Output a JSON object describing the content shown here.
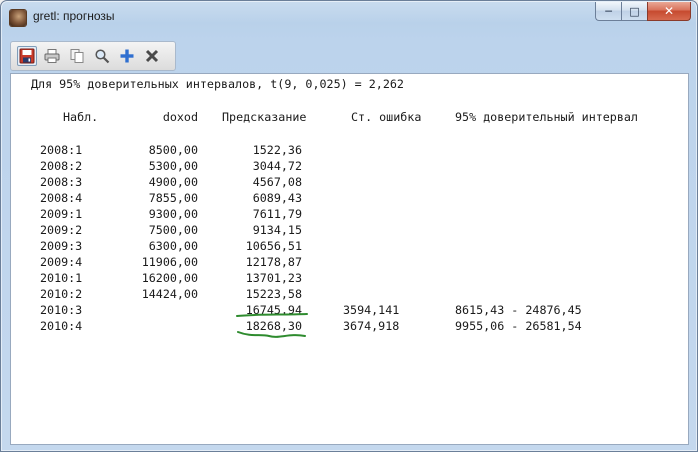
{
  "window": {
    "title": "gretl: прогнозы",
    "buttons": {
      "minimize": "─",
      "maximize": "□",
      "close": "✕"
    }
  },
  "toolbar": {
    "items": [
      {
        "name": "save-icon",
        "tooltip": ""
      },
      {
        "name": "print-icon",
        "tooltip": ""
      },
      {
        "name": "copy-icon",
        "tooltip": ""
      },
      {
        "name": "find-icon",
        "tooltip": ""
      },
      {
        "name": "add-icon",
        "tooltip": ""
      },
      {
        "name": "close-icon",
        "tooltip": ""
      }
    ]
  },
  "output": {
    "interval_line": "Для 95% доверительных интервалов, t(9, 0,025) = 2,262",
    "headers": {
      "obs": "Набл.",
      "doxod": "doxod",
      "prediction": "Предсказание",
      "std_error": "Ст. ошибка",
      "interval": "95% доверительный интервал"
    },
    "rows": [
      {
        "obs": "2008:1",
        "doxod": "8500,00",
        "prediction": "1522,36",
        "std_error": "",
        "interval": ""
      },
      {
        "obs": "2008:2",
        "doxod": "5300,00",
        "prediction": "3044,72",
        "std_error": "",
        "interval": ""
      },
      {
        "obs": "2008:3",
        "doxod": "4900,00",
        "prediction": "4567,08",
        "std_error": "",
        "interval": ""
      },
      {
        "obs": "2008:4",
        "doxod": "7855,00",
        "prediction": "6089,43",
        "std_error": "",
        "interval": ""
      },
      {
        "obs": "2009:1",
        "doxod": "9300,00",
        "prediction": "7611,79",
        "std_error": "",
        "interval": ""
      },
      {
        "obs": "2009:2",
        "doxod": "7500,00",
        "prediction": "9134,15",
        "std_error": "",
        "interval": ""
      },
      {
        "obs": "2009:3",
        "doxod": "6300,00",
        "prediction": "10656,51",
        "std_error": "",
        "interval": ""
      },
      {
        "obs": "2009:4",
        "doxod": "11906,00",
        "prediction": "12178,87",
        "std_error": "",
        "interval": ""
      },
      {
        "obs": "2010:1",
        "doxod": "16200,00",
        "prediction": "13701,23",
        "std_error": "",
        "interval": ""
      },
      {
        "obs": "2010:2",
        "doxod": "14424,00",
        "prediction": "15223,58",
        "std_error": "",
        "interval": ""
      },
      {
        "obs": "2010:3",
        "doxod": "",
        "prediction": "16745,94",
        "std_error": "3594,141",
        "interval": "8615,43 - 24876,45"
      },
      {
        "obs": "2010:4",
        "doxod": "",
        "prediction": "18268,30",
        "std_error": "3674,918",
        "interval": "9955,06 - 26581,54"
      }
    ]
  },
  "annotation": {
    "underline_color": "#2e8b2e"
  }
}
